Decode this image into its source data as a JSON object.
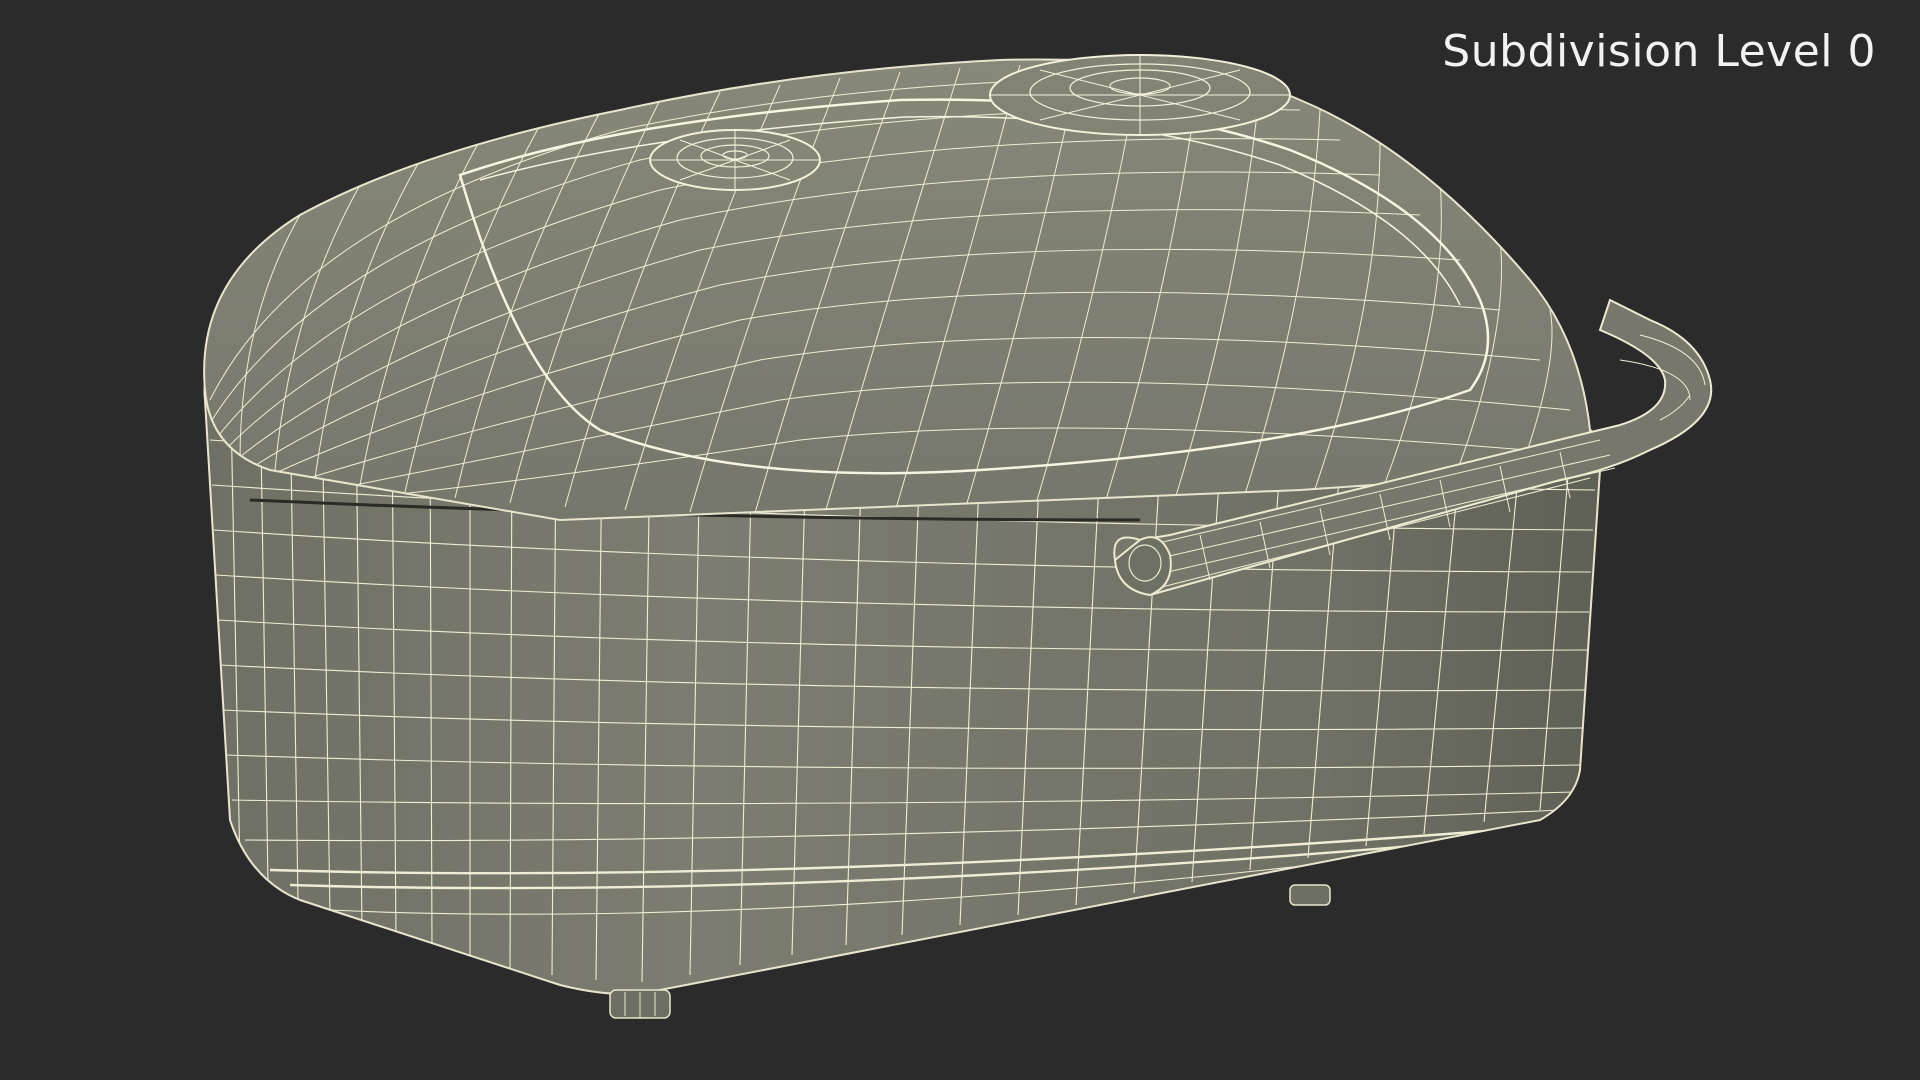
{
  "viewport": {
    "overlay_label": "Subdivision Level 0",
    "background_color": "#2b2b2b",
    "model_fill_color": "#7b7c6f",
    "wire_color": "#f4f0da",
    "subject": "rice-cooker-wireframe-model"
  }
}
